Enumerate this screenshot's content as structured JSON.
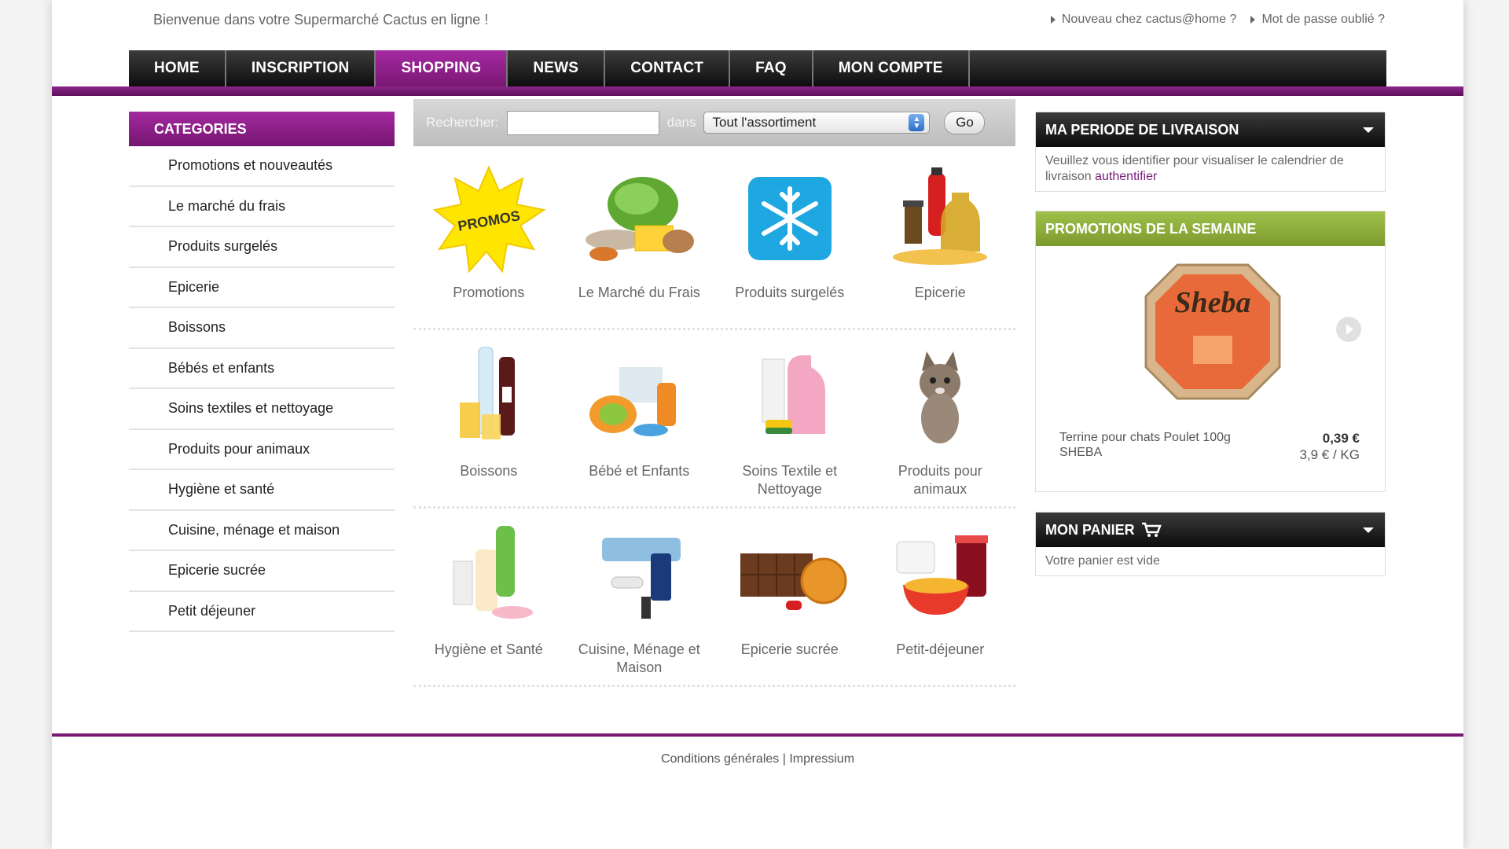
{
  "top": {
    "welcome": "Bienvenue dans votre Supermarché Cactus en ligne !",
    "links": [
      "Nouveau chez cactus@home ?",
      "Mot de passe oublié ?"
    ]
  },
  "nav": {
    "items": [
      "HOME",
      "INSCRIPTION",
      "SHOPPING",
      "NEWS",
      "CONTACT",
      "FAQ",
      "MON COMPTE"
    ],
    "active": "SHOPPING"
  },
  "categories": {
    "title": "CATEGORIES",
    "items": [
      "Promotions et nouveautés",
      "Le marché du frais",
      "Produits surgelés",
      "Epicerie",
      "Boissons",
      "Bébés et enfants",
      "Soins textiles et nettoyage",
      "Produits pour animaux",
      "Hygiène et santé",
      "Cuisine, ménage et maison",
      "Epicerie sucrée",
      "Petit déjeuner"
    ]
  },
  "search": {
    "label": "Rechercher:",
    "value": "",
    "in_label": "dans",
    "scope": "Tout l'assortiment",
    "go": "Go"
  },
  "grid": [
    {
      "label": "Promotions",
      "icon": "promos-star-icon"
    },
    {
      "label": "Le Marché du Frais",
      "icon": "fresh-market-icon"
    },
    {
      "label": "Produits surgelés",
      "icon": "snowflake-icon"
    },
    {
      "label": "Epicerie",
      "icon": "grocery-icon"
    },
    {
      "label": "Boissons",
      "icon": "drinks-icon"
    },
    {
      "label": "Bébé et Enfants",
      "icon": "baby-icon"
    },
    {
      "label": "Soins Textile et Nettoyage",
      "icon": "detergent-icon"
    },
    {
      "label": "Produits pour animaux",
      "icon": "kitten-icon"
    },
    {
      "label": "Hygiène et Santé",
      "icon": "hygiene-icon"
    },
    {
      "label": "Cuisine, Ménage et Maison",
      "icon": "household-icon"
    },
    {
      "label": "Epicerie sucrée",
      "icon": "sweets-icon"
    },
    {
      "label": "Petit-déjeuner",
      "icon": "breakfast-icon"
    }
  ],
  "promo_badge_text": "PROMOS",
  "delivery": {
    "title": "MA PERIODE DE LIVRAISON",
    "text": "Veuillez vous identifier pour visualiser le calendrier de livraison",
    "link": "authentifier"
  },
  "weekly_promos": {
    "title": "PROMOTIONS DE LA SEMAINE",
    "brand": "Sheba",
    "product": "Terrine pour chats Poulet 100g SHEBA",
    "price": "0,39 €",
    "unit_price": "3,9 € / KG"
  },
  "cart": {
    "title": "MON PANIER",
    "empty": "Votre panier est vide"
  },
  "footer": {
    "conditions": "Conditions générales",
    "separator": "|",
    "impressum": "Impressium"
  },
  "colors": {
    "brand_purple": "#8c268b",
    "promo_green": "#8fae3c",
    "nav_black": "#1a1a1a"
  }
}
